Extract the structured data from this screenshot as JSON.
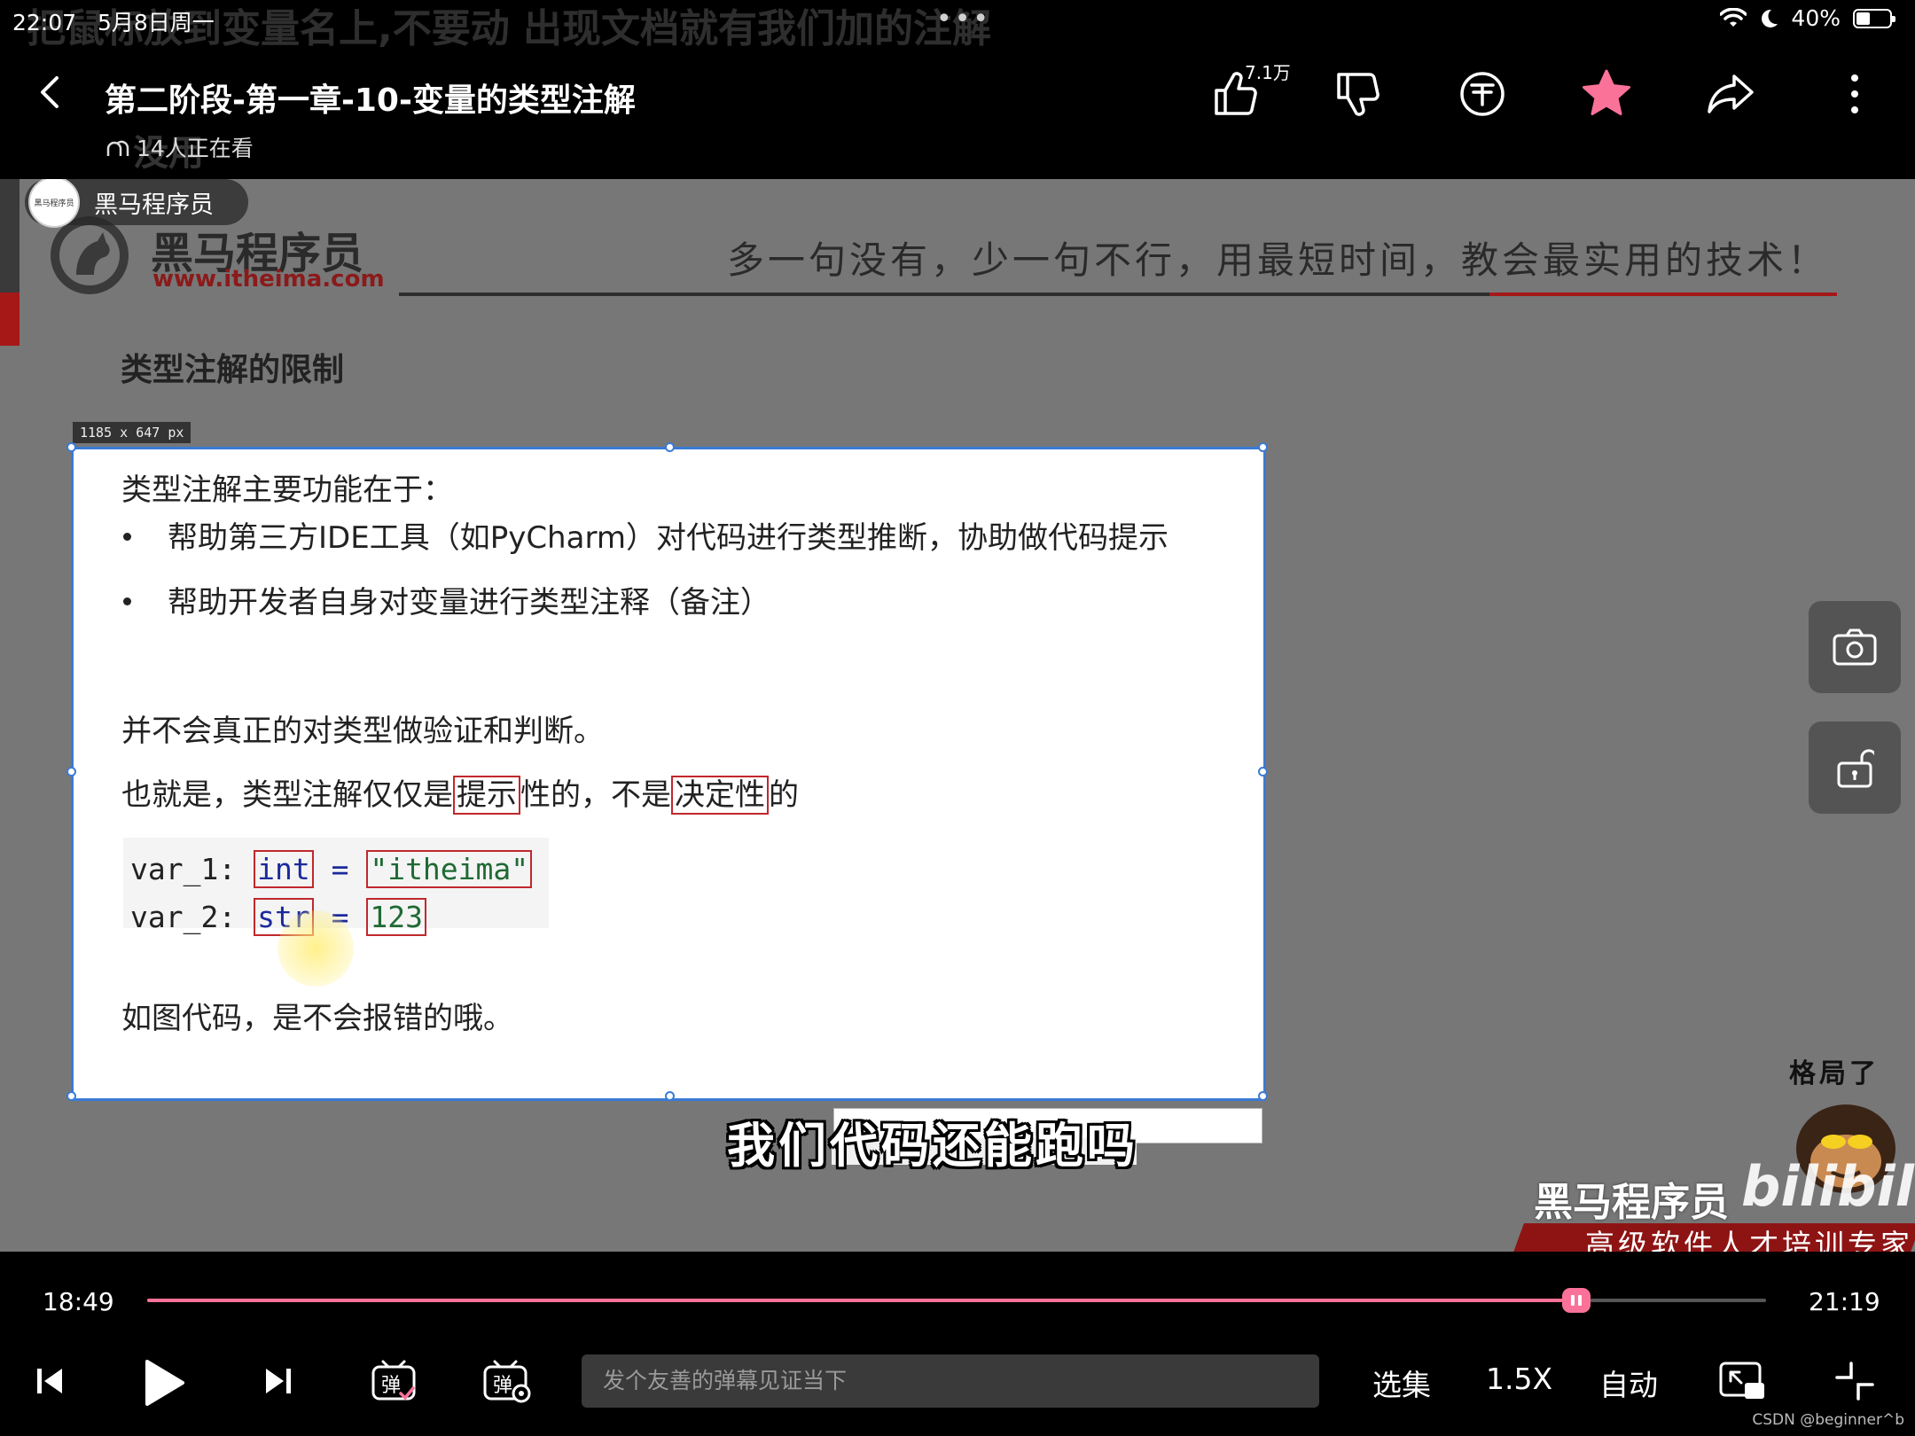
{
  "status_bar": {
    "time": "22:07",
    "date": "5月8日周一",
    "dots": "•••",
    "battery_percent": "40%",
    "battery_level": 0.4
  },
  "overlay": {
    "top_ghost_text": "把鼠标放到变量名上,不要动 出现文档就有我们加的注解",
    "sub_ghost_text": "没用"
  },
  "header": {
    "title": "第二阶段-第一章-10-变量的类型注解",
    "viewers": "14人正在看",
    "like_count": "7.1万",
    "icons": [
      "back-arrow-icon",
      "thumbs-up-icon",
      "thumbs-down-icon",
      "coin-icon",
      "star-icon",
      "share-icon",
      "more-icon"
    ],
    "accent_color": "#fb7299"
  },
  "video": {
    "channel": {
      "name": "黑马程序员",
      "avatar_text": "黑马程序员"
    },
    "brand": {
      "name": "黑马程序员",
      "url": "www.itheima.com"
    },
    "slogan": "多一句没有，少一句不行，用最短时间，教会最实用的技术！",
    "slide_heading": "类型注解的限制",
    "size_label": "1185 x 647  px",
    "slide": {
      "intro": "类型注解主要功能在于：",
      "bullets": [
        "帮助第三方IDE工具（如PyCharm）对代码进行类型推断，协助做代码提示",
        "帮助开发者自身对变量进行类型注释（备注）"
      ],
      "note1": "并不会真正的对类型做验证和判断。",
      "note2": {
        "p1": "也就是，类型注解仅仅是",
        "h1": "提示",
        "p2": "性的，不是",
        "h2": "决定性",
        "p3": "的"
      },
      "code": [
        {
          "name": "var_1",
          "colon": ":",
          "type": "int",
          "eq": "=",
          "value": "\"itheima\""
        },
        {
          "name": "var_2",
          "colon": ":",
          "type": "str",
          "eq": "=",
          "value": "123"
        }
      ],
      "footer": "如图代码，是不会报错的哦。"
    },
    "subtitle": "我们代码还能跑吗",
    "watermark": {
      "tag": "格局了",
      "name": "黑马程序员",
      "bili": "bilibili",
      "slogan": "高级软件人才培训专家"
    },
    "side_buttons": [
      "camera-icon",
      "unlock-icon"
    ]
  },
  "controls": {
    "current_time": "18:49",
    "total_time": "21:19",
    "progress": 0.8827,
    "danmaku_placeholder": "发个友善的弹幕见证当下",
    "danmaku_icon_label": "弹",
    "episodes_label": "选集",
    "speed_label": "1.5X",
    "quality_label": "自动",
    "icons": [
      "previous-icon",
      "play-icon",
      "next-icon",
      "danmaku-toggle-icon",
      "danmaku-settings-icon",
      "pip-icon",
      "exit-fullscreen-icon"
    ]
  },
  "csdn_watermark": "CSDN @beginner^b"
}
